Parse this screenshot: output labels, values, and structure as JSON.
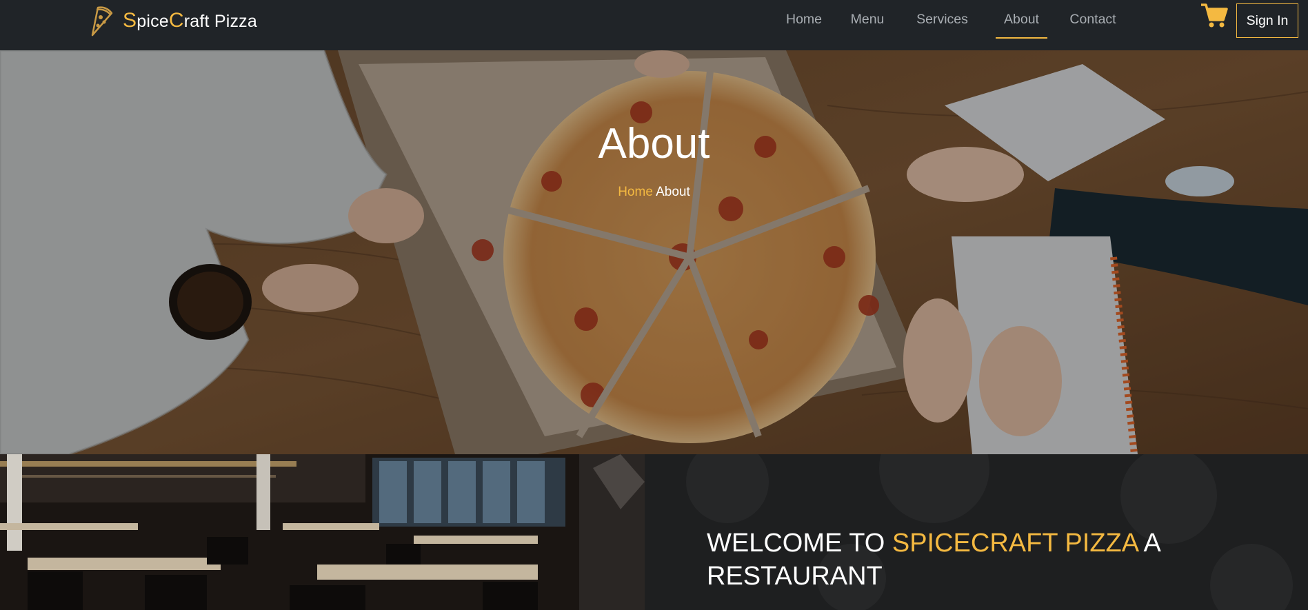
{
  "brand": {
    "initial1": "S",
    "part1": "pice",
    "initial2": "C",
    "part2": "raft Pizza",
    "logo_icon": "pizza-slice-icon"
  },
  "nav": {
    "links": [
      {
        "label": "Home",
        "active": false
      },
      {
        "label": "Menu",
        "active": false
      },
      {
        "label": "Services",
        "active": false
      },
      {
        "label": "About",
        "active": true
      },
      {
        "label": "Contact",
        "active": false
      }
    ],
    "cart_icon": "cart-icon",
    "signin_label": "Sign In"
  },
  "hero": {
    "title": "About",
    "breadcrumb": {
      "home": "Home",
      "current": "About"
    },
    "background": "photo-hands-sharing-pizza-on-wooden-table"
  },
  "welcome": {
    "prefix": "WELCOME TO ",
    "highlight": "SPICECRAFT PIZZA",
    "suffix": " A RESTAURANT",
    "photo": "photo-restaurant-interior"
  },
  "colors": {
    "accent": "#f4b941",
    "navbar_bg": "#202428",
    "nav_text": "#a9aeb3",
    "panel_bg": "#1d1d1e"
  }
}
